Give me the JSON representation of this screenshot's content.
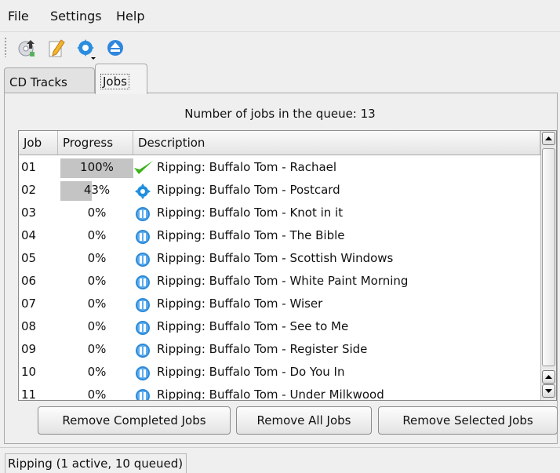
{
  "menu": {
    "items": [
      "File",
      "Settings",
      "Help"
    ]
  },
  "toolbar": {
    "buttons": [
      "add-cd-icon",
      "edit-icon",
      "configure-icon",
      "eject-icon"
    ]
  },
  "tabs": [
    "CD Tracks",
    "Jobs"
  ],
  "active_tab": "Jobs",
  "queue": {
    "label": "Number of jobs in the queue: 13"
  },
  "table": {
    "headers": [
      "Job",
      "Progress",
      "Description"
    ],
    "rows": [
      {
        "job": "01",
        "progress": "100%",
        "fill": 1.0,
        "icon": "check-icon",
        "description": "Ripping: Buffalo Tom - Rachael"
      },
      {
        "job": "02",
        "progress": "43%",
        "fill": 0.43,
        "icon": "running-gear-icon",
        "description": "Ripping: Buffalo Tom - Postcard"
      },
      {
        "job": "03",
        "progress": "0%",
        "fill": 0,
        "icon": "queued-pause-icon",
        "description": "Ripping: Buffalo Tom - Knot in it"
      },
      {
        "job": "04",
        "progress": "0%",
        "fill": 0,
        "icon": "queued-pause-icon",
        "description": "Ripping: Buffalo Tom - The Bible"
      },
      {
        "job": "05",
        "progress": "0%",
        "fill": 0,
        "icon": "queued-pause-icon",
        "description": "Ripping: Buffalo Tom - Scottish Windows"
      },
      {
        "job": "06",
        "progress": "0%",
        "fill": 0,
        "icon": "queued-pause-icon",
        "description": "Ripping: Buffalo Tom - White Paint Morning"
      },
      {
        "job": "07",
        "progress": "0%",
        "fill": 0,
        "icon": "queued-pause-icon",
        "description": "Ripping: Buffalo Tom - Wiser"
      },
      {
        "job": "08",
        "progress": "0%",
        "fill": 0,
        "icon": "queued-pause-icon",
        "description": "Ripping: Buffalo Tom - See to Me"
      },
      {
        "job": "09",
        "progress": "0%",
        "fill": 0,
        "icon": "queued-pause-icon",
        "description": "Ripping: Buffalo Tom - Register Side"
      },
      {
        "job": "10",
        "progress": "0%",
        "fill": 0,
        "icon": "queued-pause-icon",
        "description": "Ripping: Buffalo Tom - Do You In"
      },
      {
        "job": "11",
        "progress": "0%",
        "fill": 0,
        "icon": "queued-pause-icon",
        "description": "Ripping: Buffalo Tom - Under Milkwood"
      }
    ]
  },
  "buttons": {
    "remove_completed": "Remove Completed Jobs",
    "remove_all": "Remove All Jobs",
    "remove_selected": "Remove Selected Jobs"
  },
  "status": {
    "text": "Ripping (1 active, 10 queued)"
  },
  "colors": {
    "progress_fill": "#c4c4c4",
    "check": "#3cb31a",
    "queued": "#2e8ad8",
    "running": "#1f8ee0"
  }
}
